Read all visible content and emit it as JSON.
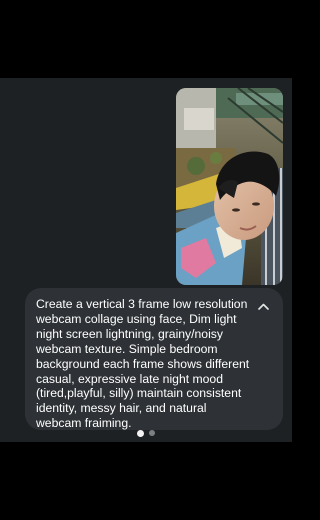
{
  "attachment": {
    "icon": "photo-thumbnail"
  },
  "prompt": {
    "text": "Create a vertical 3 frame low resolution webcam collage using face, Dim light night screen lightning, grainy/noisy webcam texture. Simple bedroom background each frame shows different casual, expressive late night mood (tired,playful, silly) maintain consistent identity, messy hair, and natural webcam fraiming.",
    "toggle_icon": "chevron-up-icon"
  },
  "pager": {
    "count": 2,
    "active_index": 0
  },
  "colors": {
    "page_background": "#000000",
    "screen_background": "#1e2124",
    "bubble_background": "#2e3236",
    "text": "#ffffff",
    "dot_active": "#f2f2f2",
    "dot_inactive": "#7c8085"
  }
}
